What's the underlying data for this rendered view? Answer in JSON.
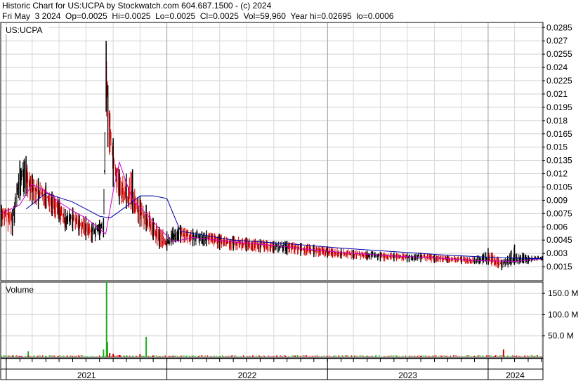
{
  "header": {
    "line1": "Historic Chart for US:UCPA by Stockwatch.com 604.687.1500 - (c) 2024",
    "line2": "Fri May  3 2024  Op=0.0025  Hi=0.0025  Lo=0.0025  Cl=0.0025  Vol=59,960  Year hi=0.02695  lo=0.0006"
  },
  "chart_data": [
    {
      "type": "candlestick",
      "symbol_label": "US:UCPA",
      "ylim": [
        0,
        0.029
      ],
      "y_ticks": [
        "0.0285",
        "0.027",
        "0.0255",
        "0.024",
        "0.0225",
        "0.021",
        "0.0195",
        "0.018",
        "0.0165",
        "0.015",
        "0.0135",
        "0.012",
        "0.0105",
        "0.009",
        "0.0075",
        "0.006",
        "0.0045",
        "0.003",
        "0.0015"
      ],
      "grid": true,
      "x_start": "2020-12-21",
      "x_end": "2024-05-03",
      "x_labels": [
        "2021",
        "2022",
        "2023",
        "2024"
      ],
      "price_series": {
        "dates": [
          "2020-12-21",
          "2021-01-15",
          "2021-02-01",
          "2021-02-15",
          "2021-03-01",
          "2021-03-15",
          "2021-04-01",
          "2021-04-15",
          "2021-05-01",
          "2021-05-15",
          "2021-06-01",
          "2021-06-15",
          "2021-07-01",
          "2021-07-15",
          "2021-08-01",
          "2021-08-10",
          "2021-08-16",
          "2021-08-20",
          "2021-09-01",
          "2021-09-15",
          "2021-10-01",
          "2021-10-15",
          "2021-11-01",
          "2021-11-15",
          "2021-12-01",
          "2021-12-15",
          "2022-01-01",
          "2022-01-15",
          "2022-02-01",
          "2022-03-01",
          "2022-04-01",
          "2022-05-01",
          "2022-06-01",
          "2022-07-01",
          "2022-08-01",
          "2022-09-01",
          "2022-10-01",
          "2022-11-01",
          "2022-12-01",
          "2023-01-01",
          "2023-02-01",
          "2023-03-01",
          "2023-04-01",
          "2023-05-01",
          "2023-06-01",
          "2023-07-01",
          "2023-08-01",
          "2023-09-01",
          "2023-10-01",
          "2023-11-01",
          "2023-12-01",
          "2024-01-01",
          "2024-02-01",
          "2024-03-01",
          "2024-04-01",
          "2024-05-03"
        ],
        "close": [
          0.0078,
          0.0072,
          0.0118,
          0.0122,
          0.0105,
          0.0098,
          0.0095,
          0.009,
          0.008,
          0.0068,
          0.007,
          0.0065,
          0.006,
          0.0055,
          0.0058,
          0.006,
          0.0245,
          0.02,
          0.014,
          0.0105,
          0.0095,
          0.009,
          0.0075,
          0.007,
          0.0055,
          0.0045,
          0.004,
          0.005,
          0.0052,
          0.0048,
          0.0048,
          0.0044,
          0.0042,
          0.0041,
          0.004,
          0.0038,
          0.0038,
          0.0035,
          0.0033,
          0.0032,
          0.003,
          0.0029,
          0.0028,
          0.0028,
          0.0027,
          0.0026,
          0.0027,
          0.0025,
          0.0024,
          0.0023,
          0.0022,
          0.0023,
          0.0019,
          0.0021,
          0.0024,
          0.0025
        ],
        "high": [
          0.0085,
          0.008,
          0.0135,
          0.014,
          0.012,
          0.0115,
          0.011,
          0.01,
          0.0092,
          0.008,
          0.0082,
          0.0075,
          0.0072,
          0.0065,
          0.0068,
          0.007,
          0.027,
          0.022,
          0.016,
          0.0125,
          0.012,
          0.0125,
          0.0095,
          0.0085,
          0.007,
          0.006,
          0.0055,
          0.006,
          0.0062,
          0.0058,
          0.0056,
          0.0052,
          0.005,
          0.0048,
          0.0046,
          0.0044,
          0.0044,
          0.0042,
          0.004,
          0.0038,
          0.0036,
          0.0034,
          0.0033,
          0.0032,
          0.0031,
          0.003,
          0.0031,
          0.0029,
          0.0028,
          0.0027,
          0.0026,
          0.0036,
          0.0023,
          0.004,
          0.0028,
          0.0027
        ],
        "low": [
          0.006,
          0.005,
          0.009,
          0.0095,
          0.0085,
          0.008,
          0.008,
          0.0072,
          0.0065,
          0.0055,
          0.0055,
          0.005,
          0.0045,
          0.0042,
          0.0045,
          0.0048,
          0.019,
          0.015,
          0.0105,
          0.0085,
          0.008,
          0.0075,
          0.006,
          0.0055,
          0.0045,
          0.0035,
          0.0033,
          0.004,
          0.0042,
          0.0038,
          0.0038,
          0.0034,
          0.0033,
          0.0032,
          0.0031,
          0.003,
          0.0028,
          0.0027,
          0.0026,
          0.0025,
          0.0024,
          0.0023,
          0.0022,
          0.0021,
          0.0021,
          0.002,
          0.002,
          0.0019,
          0.0019,
          0.0018,
          0.0018,
          0.0017,
          0.0011,
          0.0017,
          0.0018,
          0.0022
        ]
      },
      "moving_averages": [
        {
          "color": "#cc00cc",
          "dates": [
            "2020-12-21",
            "2021-02-01",
            "2021-03-01",
            "2021-04-01",
            "2021-05-01",
            "2021-06-01",
            "2021-07-01",
            "2021-08-15",
            "2021-09-01",
            "2021-09-15",
            "2021-10-15",
            "2021-11-15",
            "2021-12-15",
            "2022-01-15",
            "2022-03-01",
            "2022-06-01",
            "2022-09-01",
            "2022-12-01",
            "2023-03-01",
            "2023-06-01",
            "2023-09-01",
            "2023-12-01",
            "2024-03-01",
            "2024-05-03"
          ],
          "values": [
            0.0075,
            0.0085,
            0.0108,
            0.01,
            0.0088,
            0.0078,
            0.007,
            0.0052,
            0.01,
            0.0133,
            0.009,
            0.0075,
            0.0058,
            0.0043,
            0.0048,
            0.0043,
            0.0039,
            0.0034,
            0.003,
            0.0027,
            0.0025,
            0.0022,
            0.0021,
            0.0024
          ]
        },
        {
          "color": "#0000aa",
          "dates": [
            "2021-02-15",
            "2021-04-01",
            "2021-06-01",
            "2021-08-01",
            "2021-08-25",
            "2021-10-01",
            "2021-11-01",
            "2021-12-01",
            "2022-01-01",
            "2022-02-01",
            "2022-06-01",
            "2022-10-01",
            "2023-02-01",
            "2023-06-01",
            "2023-10-01",
            "2024-02-01",
            "2024-05-03"
          ],
          "values": [
            0.008,
            0.0098,
            0.0088,
            0.0072,
            0.007,
            0.0083,
            0.0095,
            0.0095,
            0.0092,
            0.0055,
            0.0045,
            0.0041,
            0.0036,
            0.0032,
            0.0028,
            0.0025,
            0.0024
          ]
        }
      ]
    },
    {
      "type": "bar",
      "title": "Volume",
      "ylim": [
        0,
        175
      ],
      "y_ticks": [
        "150.0 M",
        "100.0 M",
        "50.0 M"
      ],
      "volume_series": {
        "dates": [
          "2021-01-15",
          "2021-02-01",
          "2021-02-20",
          "2021-04-01",
          "2021-06-01",
          "2021-08-10",
          "2021-08-17",
          "2021-08-19",
          "2021-08-24",
          "2021-09-01",
          "2021-09-15",
          "2021-10-01",
          "2021-11-01",
          "2021-11-08",
          "2021-11-15",
          "2021-12-01",
          "2022-01-15",
          "2022-03-01",
          "2022-05-01",
          "2022-08-01",
          "2022-10-20",
          "2023-01-15",
          "2023-04-01",
          "2023-08-01",
          "2023-12-01",
          "2024-01-15",
          "2024-02-05",
          "2024-03-01",
          "2024-04-15"
        ],
        "values": [
          2,
          3,
          14,
          2,
          2,
          18,
          178,
          35,
          10,
          8,
          5,
          4,
          7,
          3,
          48,
          4,
          3,
          2,
          2,
          2,
          4,
          2,
          2,
          2,
          2,
          3,
          18,
          2,
          3
        ],
        "colors": [
          "r",
          "r",
          "g",
          "r",
          "r",
          "g",
          "g",
          "g",
          "r",
          "r",
          "r",
          "g",
          "r",
          "g",
          "g",
          "r",
          "r",
          "r",
          "g",
          "r",
          "g",
          "r",
          "r",
          "r",
          "r",
          "r",
          "r",
          "r",
          "g"
        ]
      }
    }
  ]
}
